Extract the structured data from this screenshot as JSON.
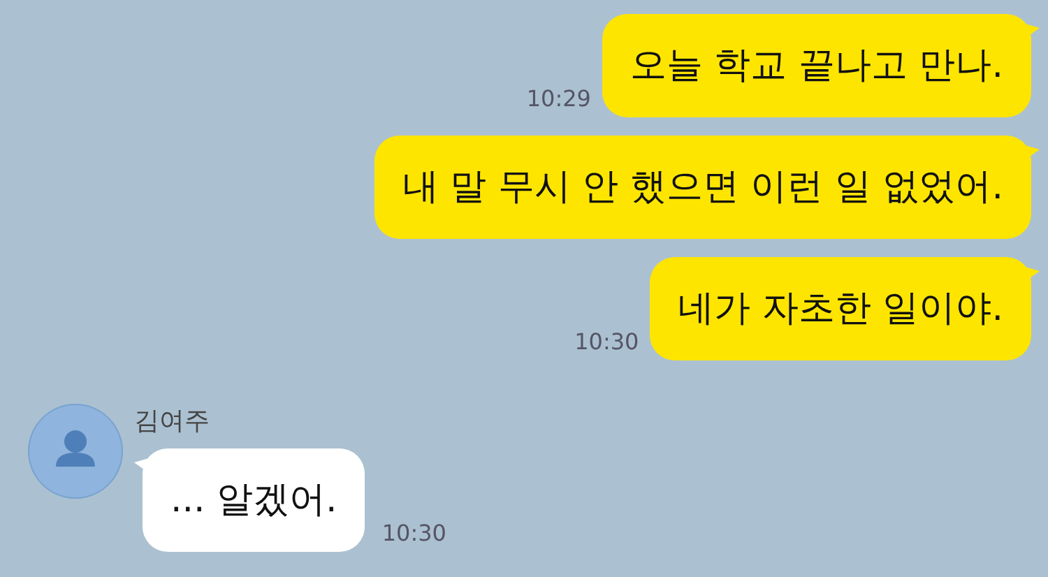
{
  "messages": [
    {
      "kind": "sent",
      "text": "오늘 학교 끝나고 만나.",
      "time": "10:29"
    },
    {
      "kind": "sent",
      "text": "내 말 무시 안 했으면 이런 일 없었어."
    },
    {
      "kind": "sent",
      "text": "네가 자초한 일이야.",
      "time": "10:30"
    },
    {
      "kind": "received",
      "sender": "김여주",
      "text": "... 알겠어.",
      "time": "10:30"
    }
  ]
}
